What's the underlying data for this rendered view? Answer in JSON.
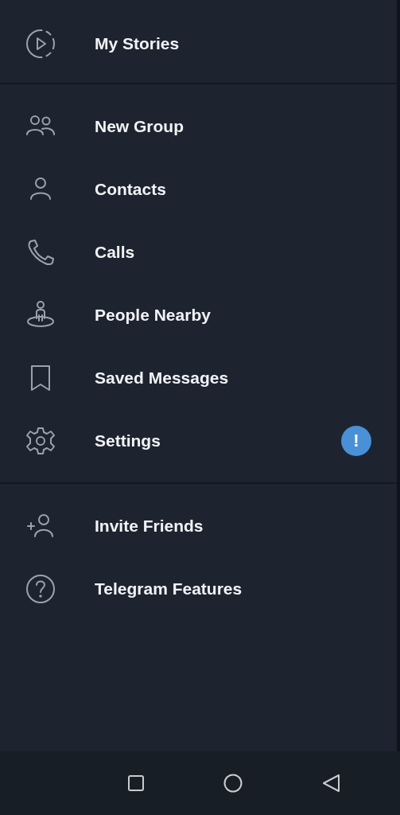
{
  "menu_sections": [
    {
      "items": [
        {
          "label": "My Stories"
        }
      ]
    },
    {
      "items": [
        {
          "label": "New Group"
        },
        {
          "label": "Contacts"
        },
        {
          "label": "Calls"
        },
        {
          "label": "People Nearby"
        },
        {
          "label": "Saved Messages"
        },
        {
          "label": "Settings",
          "badge": "!"
        }
      ]
    },
    {
      "items": [
        {
          "label": "Invite Friends"
        },
        {
          "label": "Telegram Features"
        }
      ]
    }
  ]
}
